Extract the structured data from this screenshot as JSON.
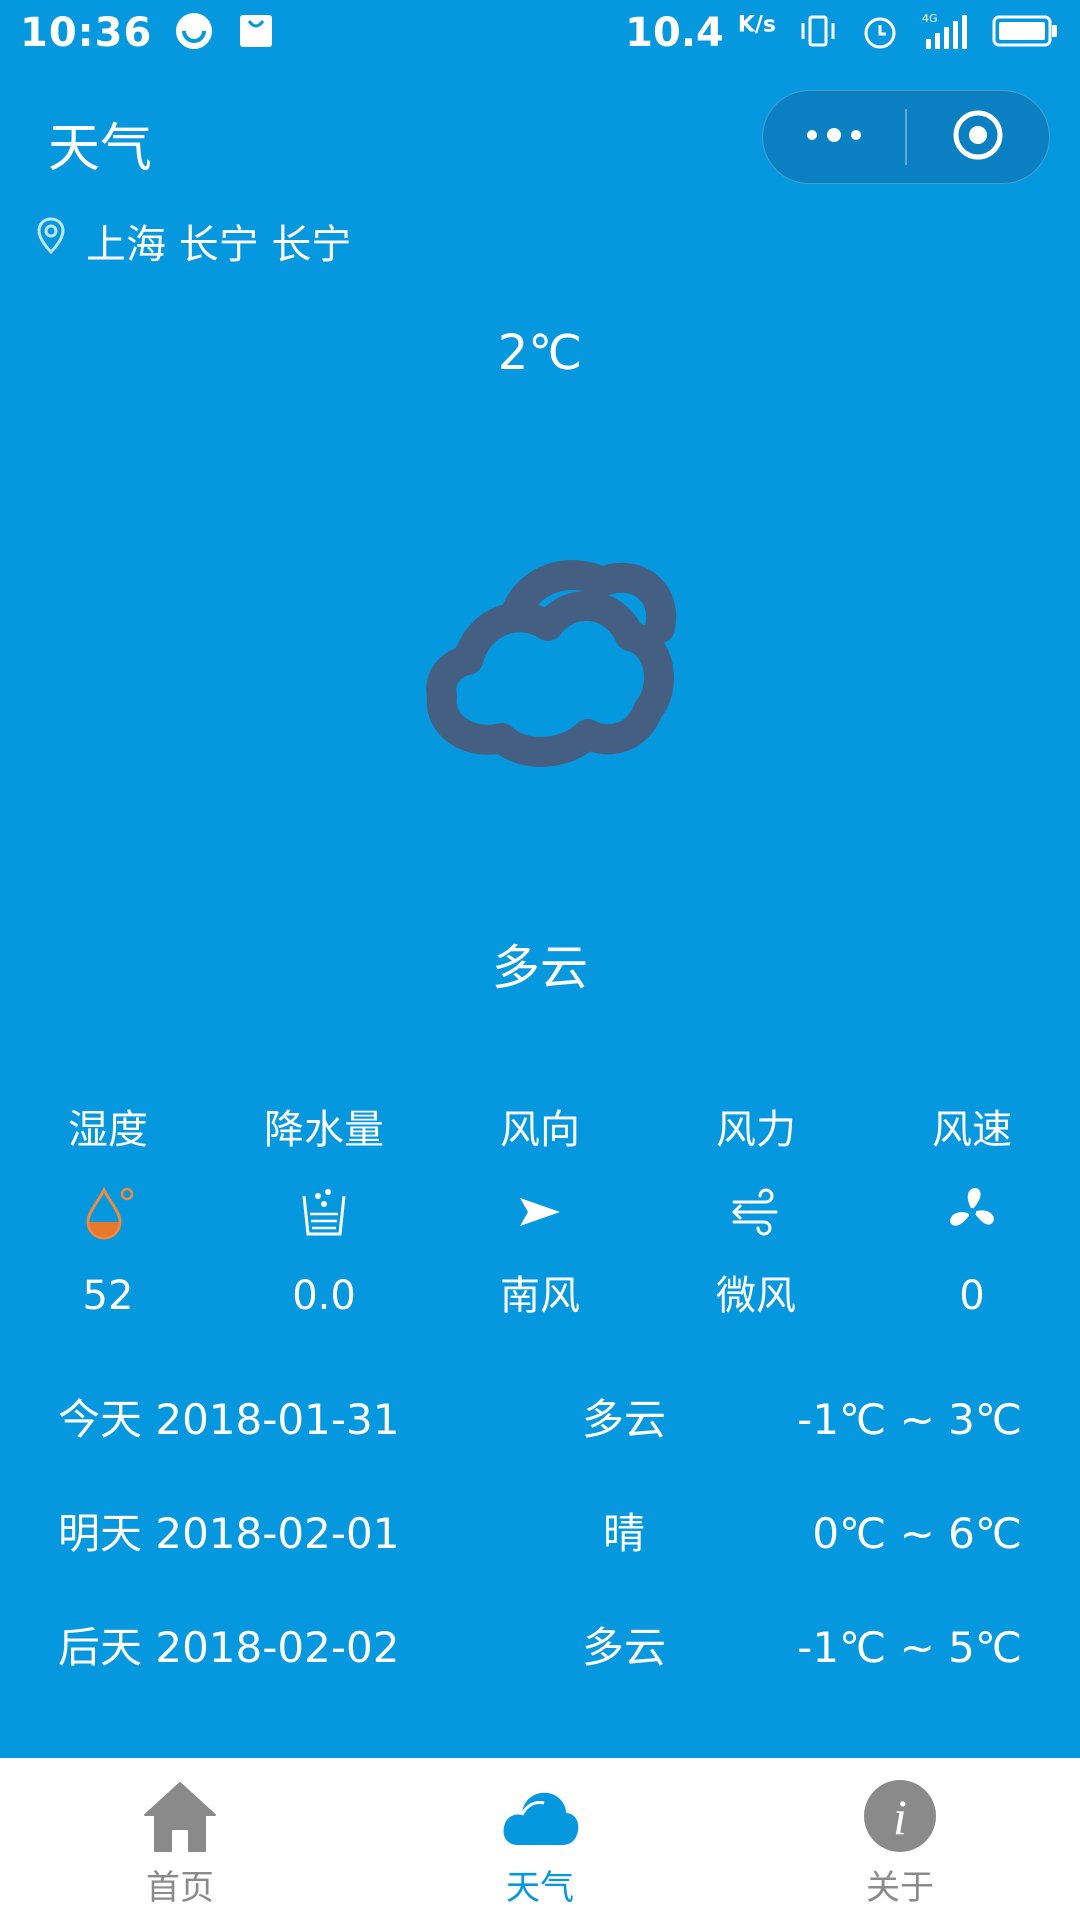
{
  "statusbar": {
    "time": "10:36",
    "net_speed": "10.4",
    "net_speed_unit": "K/s",
    "network": "4G"
  },
  "header": {
    "title": "天气",
    "more_icon": "more-dots-icon",
    "close_icon": "target-circle-icon"
  },
  "location": {
    "icon": "location-pin-icon",
    "text": "上海 长宁 长宁"
  },
  "current": {
    "temperature": "2℃",
    "icon": "cloudy-icon",
    "description": "多云"
  },
  "metrics": [
    {
      "label": "湿度",
      "icon": "humidity-drop-icon",
      "value": "52"
    },
    {
      "label": "降水量",
      "icon": "precipitation-cup-icon",
      "value": "0.0"
    },
    {
      "label": "风向",
      "icon": "wind-direction-arrow-icon",
      "value": "南风"
    },
    {
      "label": "风力",
      "icon": "wind-lines-icon",
      "value": "微风"
    },
    {
      "label": "风速",
      "icon": "fan-icon",
      "value": "0"
    }
  ],
  "forecast": [
    {
      "day": "今天 2018-01-31",
      "desc": "多云",
      "temp": "-1℃ ~ 3℃"
    },
    {
      "day": "明天 2018-02-01",
      "desc": "晴",
      "temp": "0℃ ~ 6℃"
    },
    {
      "day": "后天 2018-02-02",
      "desc": "多云",
      "temp": "-1℃ ~ 5℃"
    }
  ],
  "tabbar": [
    {
      "label": "首页",
      "icon": "home-icon",
      "active": false
    },
    {
      "label": "天气",
      "icon": "cloud-icon",
      "active": true
    },
    {
      "label": "关于",
      "icon": "info-icon",
      "active": false
    }
  ],
  "colors": {
    "background": "#0698df",
    "cloud_icon": "#455f83",
    "humidity_fill": "#e8772e",
    "tab_inactive": "#8a8a8a",
    "tab_active": "#0698df"
  }
}
